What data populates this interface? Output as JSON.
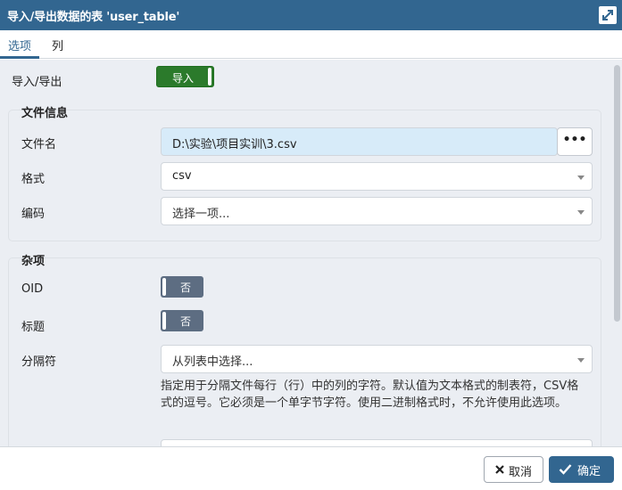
{
  "dialog": {
    "title": "导入/导出数据的表 'user_table'"
  },
  "tabs": [
    {
      "label": "选项",
      "active": true
    },
    {
      "label": "列",
      "active": false
    }
  ],
  "import_export": {
    "label": "导入/导出",
    "toggle_label": "导入"
  },
  "file_info": {
    "legend": "文件信息",
    "filename_label": "文件名",
    "filename_value": "D:\\实验\\项目实训\\3.csv",
    "browse_label": "•••",
    "format_label": "格式",
    "format_value": "csv",
    "encoding_label": "编码",
    "encoding_placeholder": "选择一项..."
  },
  "misc": {
    "legend": "杂项",
    "oid_label": "OID",
    "oid_toggle": "否",
    "header_label": "标题",
    "header_toggle": "否",
    "delimiter_label": "分隔符",
    "delimiter_placeholder": "从列表中选择...",
    "delimiter_help": "指定用于分隔文件每行（行）中的列的字符。默认值为文本格式的制表符，CSV格式的逗号。它必须是一个单字节字符。使用二进制格式时，不允许使用此选项。"
  },
  "footer": {
    "cancel_label": "取消",
    "ok_label": "确定"
  },
  "colors": {
    "primary": "#326690",
    "toggle_on": "#2b7a2b",
    "toggle_off": "#5d6d82",
    "panel_bg": "#ebeef3",
    "input_filled": "#d7ebf9"
  },
  "icons": {
    "maximize": "maximize-icon",
    "close": "close-icon",
    "check": "check-icon",
    "dropdown": "chevron-down-icon"
  }
}
